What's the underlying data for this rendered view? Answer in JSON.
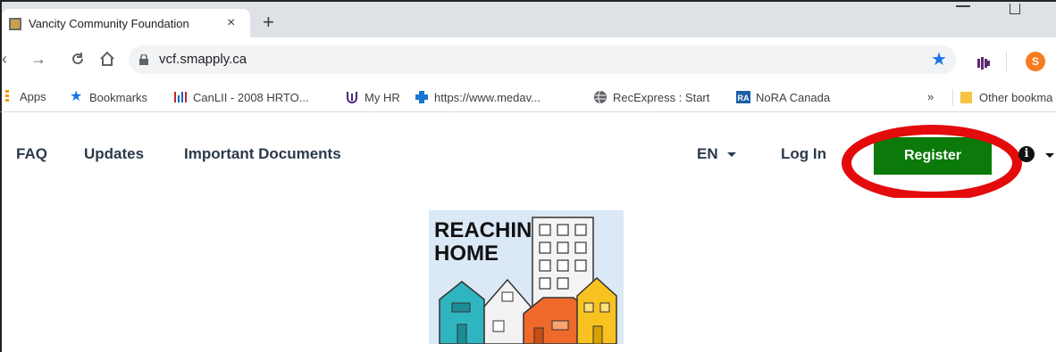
{
  "browser": {
    "tab": {
      "title": "Vancity Community Foundation",
      "close": "×"
    },
    "new_tab": "+",
    "url": "vcf.smapply.ca",
    "profile_initial": "S"
  },
  "bookmarks": [
    {
      "label": "Apps",
      "icon": "apps-icon"
    },
    {
      "label": "Bookmarks",
      "icon": "star-icon"
    },
    {
      "label": "CanLII - 2008 HRTO...",
      "icon": "canlii-icon"
    },
    {
      "label": "My HR",
      "icon": "myhr-icon"
    },
    {
      "label": "https://www.medav...",
      "icon": "medical-cross-icon"
    },
    {
      "label": "RecExpress : Start",
      "icon": "globe-icon"
    },
    {
      "label": "NoRA Canada",
      "icon": "ra-icon"
    },
    {
      "label": "»",
      "icon": "overflow-icon"
    },
    {
      "label": "Other bookma",
      "icon": "folder-icon"
    }
  ],
  "site_nav": {
    "links": [
      "FAQ",
      "Updates",
      "Important Documents"
    ],
    "language": "EN",
    "login": "Log In",
    "register": "Register"
  },
  "logo": {
    "line1": "REACHING",
    "line2": "HOME"
  },
  "colors": {
    "register_bg": "#0b7a0b",
    "highlight_ring": "#e30b0b",
    "nav_text": "#2b3a4a",
    "chrome_bg": "#dee1e6",
    "star_blue": "#1a73e8",
    "avatar_orange": "#f57c1f"
  }
}
